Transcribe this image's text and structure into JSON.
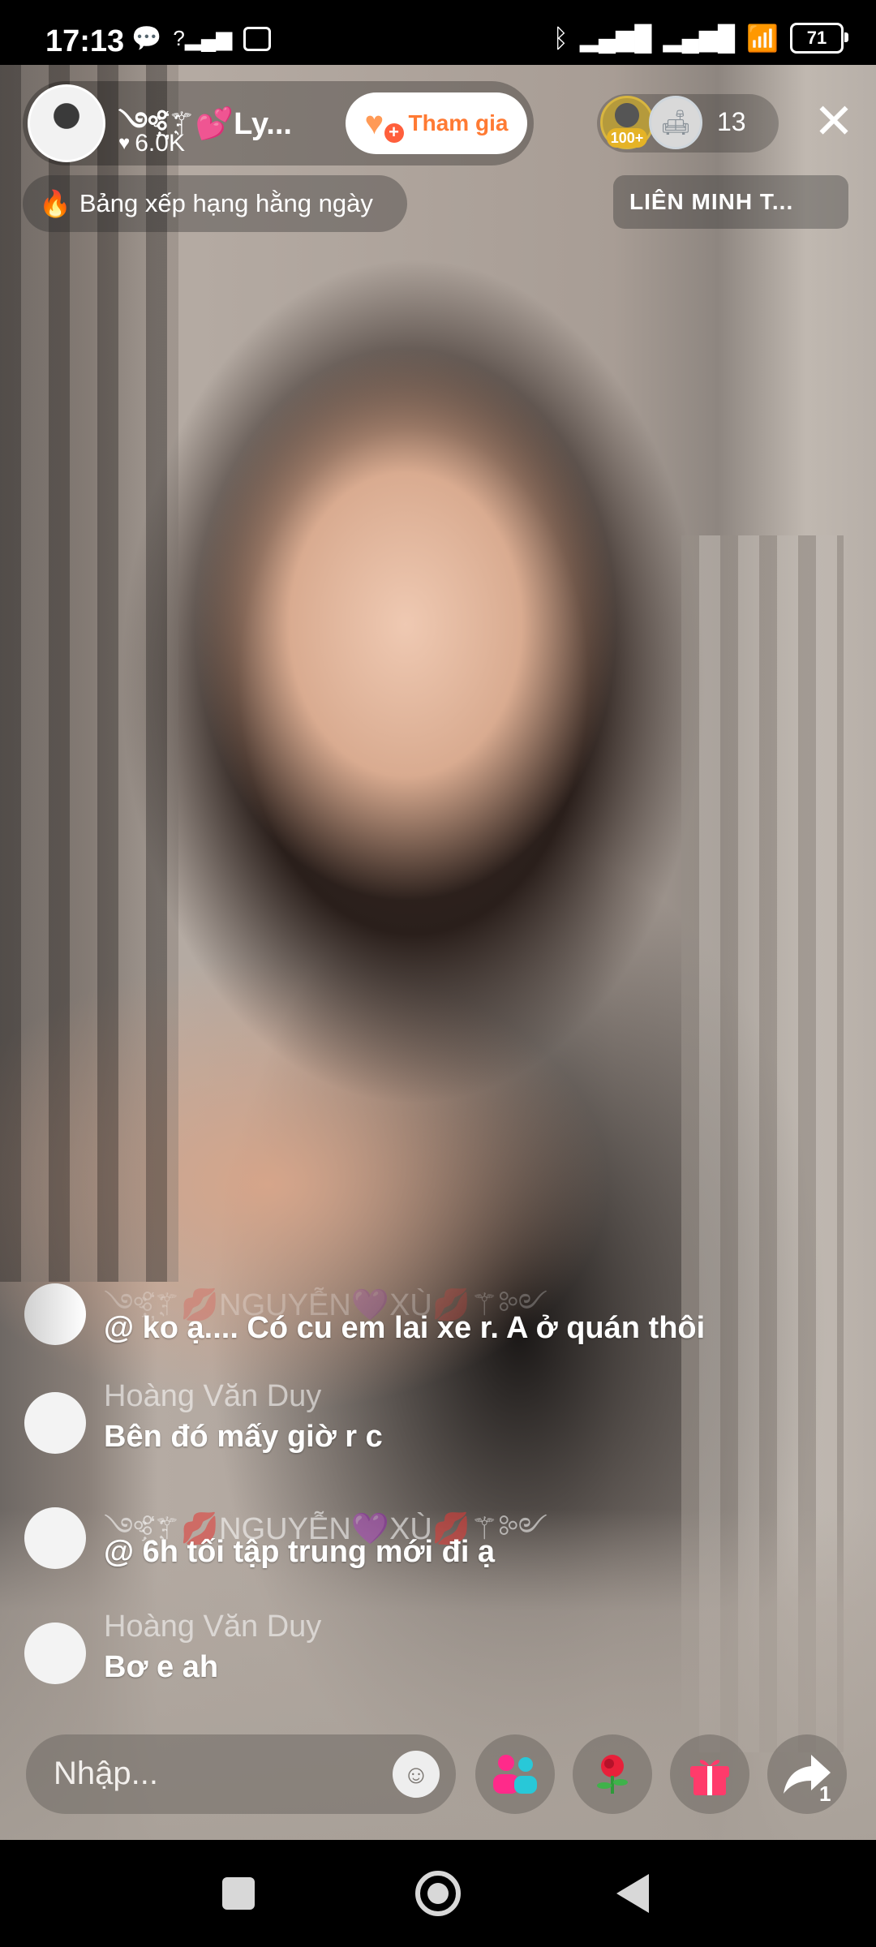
{
  "status_bar": {
    "time": "17:13",
    "battery": "71",
    "icons": [
      "chat-bubble-icon",
      "no-signal-icon",
      "app-icon",
      "bluetooth-icon",
      "signal-icon",
      "signal-icon",
      "wifi-icon",
      "battery-icon"
    ]
  },
  "host": {
    "name": "༺҉⚚💕Ly...",
    "likes": "6.0K",
    "join_label": "Tham gia"
  },
  "viewers": {
    "top_badge": "100+",
    "count": "13"
  },
  "ranking_label": "Bảng xếp hạng hằng ngày",
  "alliance_label": "LIÊN MINH T...",
  "comments": [
    {
      "name": "༺҉⚚💋NGUYỄN💜XÙ💋⚚༻",
      "text": "@ ko ạ.... Có cu em lai xe r. A ở quán thôi"
    },
    {
      "name": "Hoàng Văn Duy",
      "text": "Bên đó mấy giờ r c"
    },
    {
      "name": "༺҉⚚💋NGUYỄN💜XÙ💋⚚༻",
      "text": "@ 6h tối tập trung mới đi ạ"
    },
    {
      "name": "Hoàng Văn Duy",
      "text": "Bơ e ah"
    }
  ],
  "input": {
    "placeholder": "Nhập..."
  },
  "share_count": "1",
  "colors": {
    "join_text": "#ff7a33",
    "gift": "#ff3b6b",
    "people": "#ff2a8a"
  }
}
